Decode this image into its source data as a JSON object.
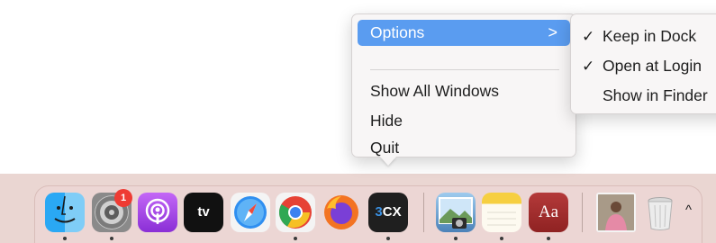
{
  "context_menu": {
    "items": [
      {
        "label": "Options",
        "has_submenu": true,
        "highlighted": true
      },
      {
        "label": "Show All Windows"
      },
      {
        "label": "Hide"
      },
      {
        "label": "Quit"
      }
    ],
    "submenu_arrow": ">"
  },
  "submenu": {
    "items": [
      {
        "label": "Keep in Dock",
        "checked": true,
        "check": "✓"
      },
      {
        "label": "Open at Login",
        "checked": true,
        "check": "✓"
      },
      {
        "label": "Show in Finder",
        "checked": false,
        "check": ""
      }
    ]
  },
  "dock": {
    "apps": [
      {
        "name": "Finder",
        "icon": "finder-icon",
        "running": true
      },
      {
        "name": "System Settings",
        "icon": "settings-icon",
        "running": true,
        "badge": "1"
      },
      {
        "name": "Podcasts",
        "icon": "podcasts-icon",
        "running": false
      },
      {
        "name": "Apple TV",
        "icon": "appletv-icon",
        "running": false,
        "label": "tv"
      },
      {
        "name": "Safari",
        "icon": "safari-icon",
        "running": false
      },
      {
        "name": "Google Chrome",
        "icon": "chrome-icon",
        "running": true
      },
      {
        "name": "Firefox",
        "icon": "firefox-icon",
        "running": false
      },
      {
        "name": "3CX",
        "icon": "3cx-icon",
        "running": true,
        "label_prefix": "3",
        "label_rest": "CX"
      },
      {
        "name": "Preview",
        "icon": "preview-icon",
        "running": true
      },
      {
        "name": "Notes",
        "icon": "notes-icon",
        "running": true
      },
      {
        "name": "Dictionary",
        "icon": "dictionary-icon",
        "running": true,
        "label": "Aa"
      },
      {
        "name": "Photo",
        "icon": "photo-icon",
        "running": false
      },
      {
        "name": "Trash",
        "icon": "trash-icon",
        "running": false
      }
    ],
    "overflow_chevron": "^"
  },
  "colors": {
    "highlight": "#5a9cf0",
    "dock_background": "#ecd6d4",
    "badge": "#ee3b33"
  }
}
